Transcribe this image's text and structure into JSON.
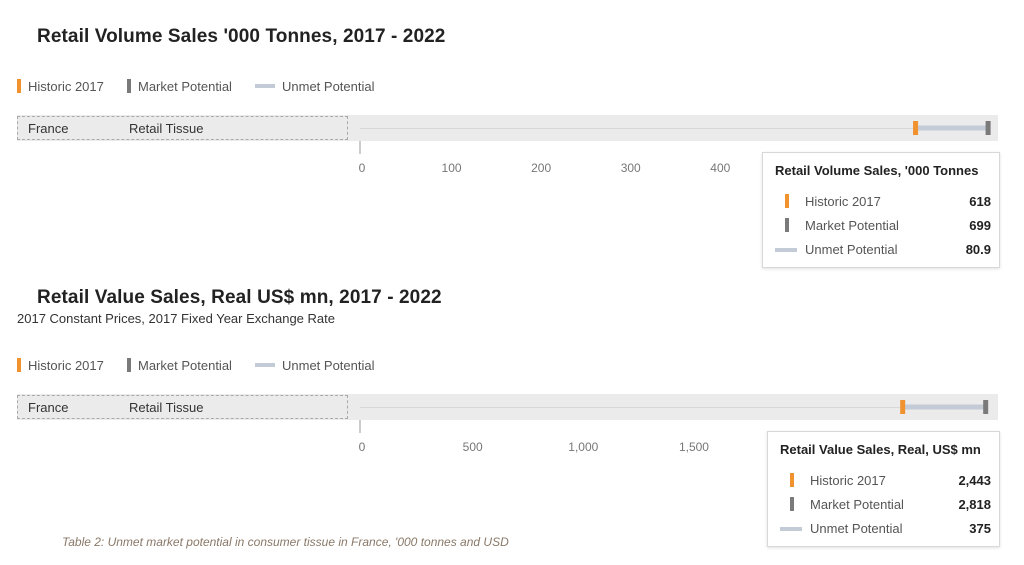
{
  "colors": {
    "historic": "#f0922e",
    "potential": "#7a7a7a",
    "unmet": "#c3cbd7"
  },
  "legend": {
    "historic": "Historic 2017",
    "potential": "Market Potential",
    "unmet": "Unmet Potential"
  },
  "volume": {
    "title": "Retail Volume Sales '000 Tonnes, 2017 - 2022",
    "row": {
      "country": "France",
      "category": "Retail Tissue"
    },
    "tooltip": {
      "title": "Retail Volume Sales, '000 Tonnes",
      "historic_value": "618",
      "potential_value": "699",
      "unmet_value": "80.9"
    }
  },
  "value": {
    "title": "Retail Value Sales, Real US$ mn, 2017 - 2022",
    "subtitle": "2017 Constant Prices, 2017 Fixed Year Exchange Rate",
    "row": {
      "country": "France",
      "category": "Retail Tissue"
    },
    "tooltip": {
      "title": "Retail Value Sales, Real, US$ mn",
      "historic_value": "2,443",
      "potential_value": "2,818",
      "unmet_value": "375"
    }
  },
  "caption": "Table 2: Unmet market potential in consumer tissue in France, '000 tonnes and USD",
  "chart_data": [
    {
      "type": "bar",
      "title": "Retail Volume Sales '000 Tonnes, 2017 - 2022",
      "categories": [
        "France — Retail Tissue"
      ],
      "series": [
        {
          "name": "Historic 2017",
          "values": [
            618
          ]
        },
        {
          "name": "Market Potential",
          "values": [
            699
          ]
        },
        {
          "name": "Unmet Potential",
          "values": [
            80.9
          ]
        }
      ],
      "xticks": [
        0,
        100,
        200,
        300,
        400
      ],
      "xtick_labels": [
        "0",
        "100",
        "200",
        "300",
        "400"
      ],
      "xlim": [
        0,
        700
      ]
    },
    {
      "type": "bar",
      "title": "Retail Value Sales, Real US$ mn, 2017 - 2022",
      "subtitle": "2017 Constant Prices, 2017 Fixed Year Exchange Rate",
      "categories": [
        "France — Retail Tissue"
      ],
      "series": [
        {
          "name": "Historic 2017",
          "values": [
            2443
          ]
        },
        {
          "name": "Market Potential",
          "values": [
            2818
          ]
        },
        {
          "name": "Unmet Potential",
          "values": [
            375
          ]
        }
      ],
      "xticks": [
        0,
        500,
        1000,
        1500
      ],
      "xtick_labels": [
        "0",
        "500",
        "1,000",
        "1,500"
      ],
      "xlim": [
        0,
        2833
      ]
    }
  ]
}
